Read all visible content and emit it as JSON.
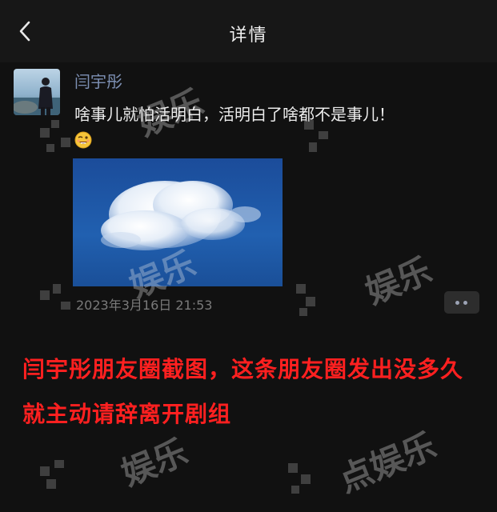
{
  "header": {
    "title": "详情"
  },
  "post": {
    "author": "闫宇彤",
    "text": "啥事儿就怕活明白，活明白了啥都不是事儿！",
    "emoji_icon": "grinning-wink-emoji-icon",
    "timestamp": "2023年3月16日 21:53"
  },
  "caption": {
    "line1": "闫宇彤朋友圈截图，这条朋友圈发出没多久",
    "line2": "就主动请辞离开剧组",
    "color": "#ff2020"
  },
  "watermarks": [
    "娱乐",
    "娱乐",
    "娱乐",
    "娱乐",
    "点娱乐"
  ],
  "colors": {
    "background": "#111111",
    "header": "#171717",
    "nickname": "#7d90b4",
    "timestamp": "#7a7a7a",
    "photo_sky": "#1d4f9e"
  }
}
